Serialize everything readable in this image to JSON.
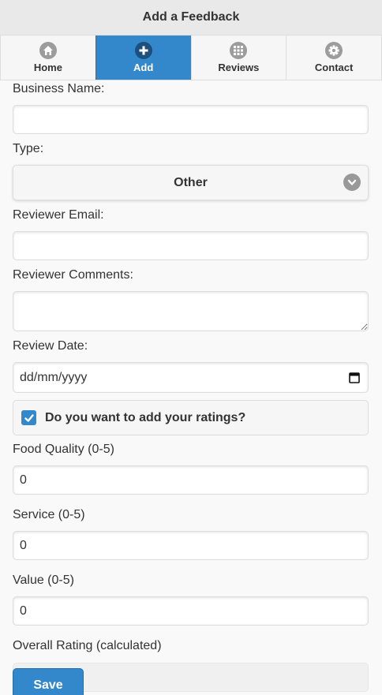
{
  "header": {
    "title": "Add a Feedback"
  },
  "nav": {
    "items": [
      {
        "label": "Home",
        "icon": "home-icon"
      },
      {
        "label": "Add",
        "icon": "plus-icon",
        "active": true
      },
      {
        "label": "Reviews",
        "icon": "grid-icon"
      },
      {
        "label": "Contact",
        "icon": "gear-icon"
      }
    ]
  },
  "form": {
    "business_name": {
      "label": "Business Name:",
      "value": ""
    },
    "type": {
      "label": "Type:",
      "value": "Other"
    },
    "reviewer_email": {
      "label": "Reviewer Email:",
      "value": ""
    },
    "reviewer_comments": {
      "label": "Reviewer Comments:",
      "value": ""
    },
    "review_date": {
      "label": "Review Date:",
      "placeholder": "dd/mm/yyyy"
    },
    "ratings_checkbox": {
      "label": "Do you want to add your ratings?",
      "checked": true
    },
    "food_quality": {
      "label": "Food Quality (0-5)",
      "value": "0"
    },
    "service": {
      "label": "Service (0-5)",
      "value": "0"
    },
    "value": {
      "label": "Value (0-5)",
      "value": "0"
    },
    "overall_rating": {
      "label": "Overall Rating (calculated)",
      "value": ""
    },
    "save_label": "Save"
  },
  "colors": {
    "accent": "#3388cc",
    "header_bg": "#e9e9e9",
    "page_bg": "#f9f9f9"
  }
}
